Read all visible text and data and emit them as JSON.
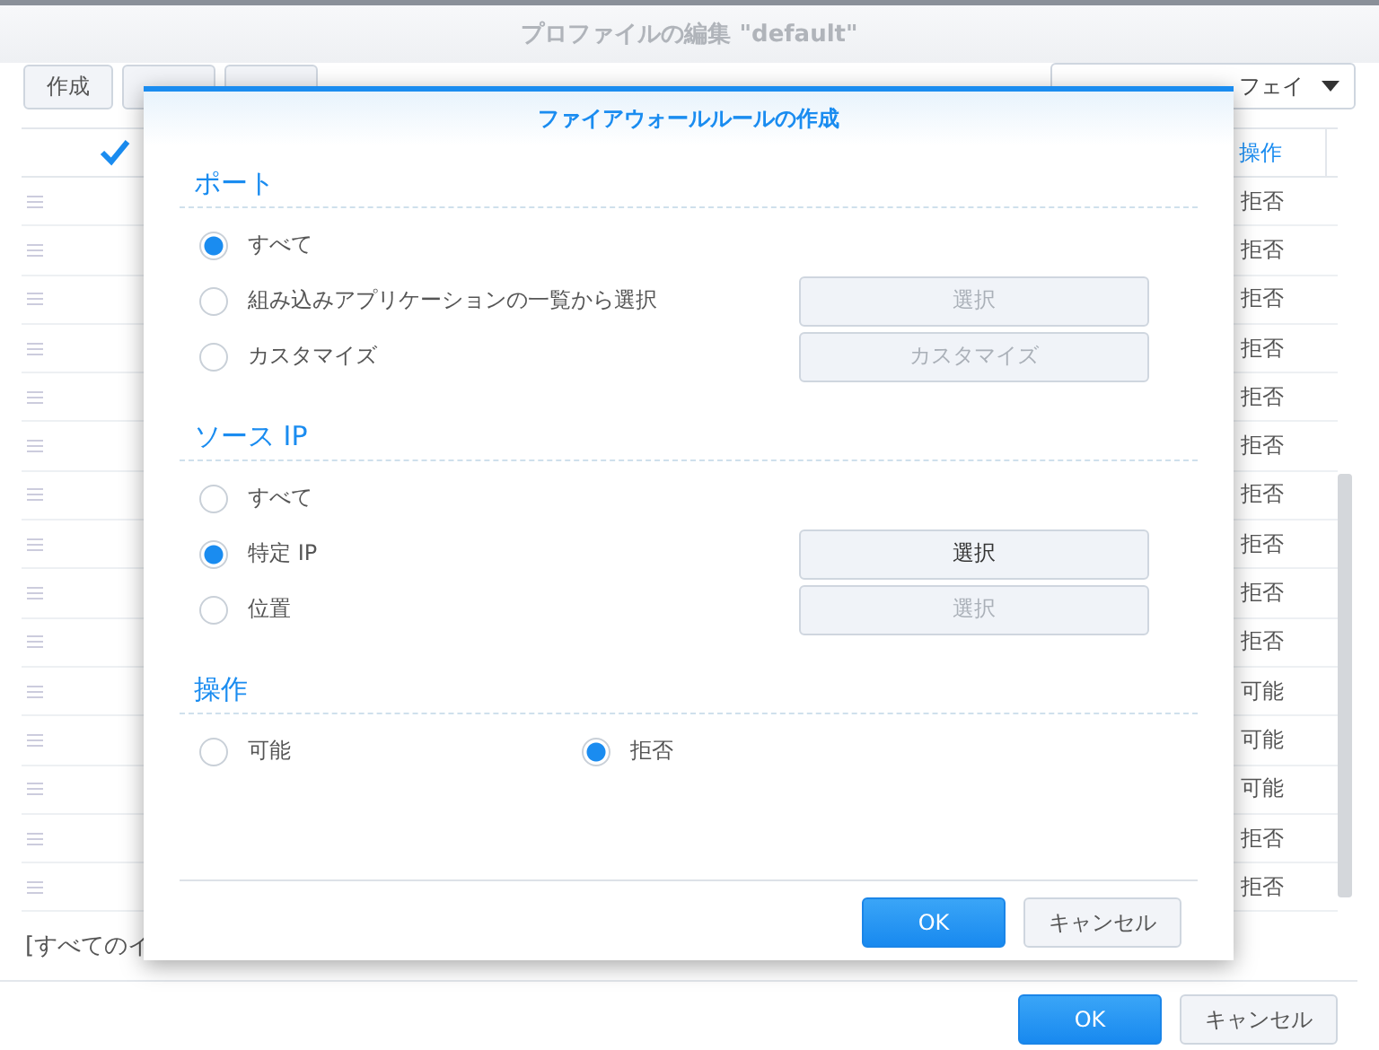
{
  "window": {
    "title": "プロファイルの編集 \"default\""
  },
  "toolbar": {
    "buttons": [
      {
        "label": "作成"
      }
    ],
    "filter": {
      "value": "フェイ"
    }
  },
  "table": {
    "header_checked": true,
    "columns": [
      {
        "label": "操作"
      }
    ],
    "rows": [
      {
        "action": "拒否"
      },
      {
        "action": "拒否"
      },
      {
        "action": "拒否"
      },
      {
        "action": "拒否"
      },
      {
        "action": "拒否"
      },
      {
        "action": "拒否"
      },
      {
        "action": "拒否"
      },
      {
        "action": "拒否"
      },
      {
        "action": "拒否"
      },
      {
        "action": "拒否"
      },
      {
        "action": "可能"
      },
      {
        "action": "可能"
      },
      {
        "action": "可能"
      },
      {
        "action": "拒否"
      },
      {
        "action": "拒否"
      }
    ]
  },
  "footer_text": "[すべてのイ",
  "buttons": [
    {
      "label": "OK",
      "kind": "primary"
    },
    {
      "label": "キャンセル",
      "kind": "secondary"
    }
  ],
  "dialog": {
    "title": "ファイアウォールルールの作成",
    "sections": [
      {
        "heading": "ポート",
        "kind": "stacked",
        "options": [
          {
            "label": "すべて",
            "selected": true
          },
          {
            "label": "組み込みアプリケーションの一覧から選択",
            "selected": false,
            "button": {
              "label": "選択",
              "disabled": true
            }
          },
          {
            "label": "カスタマイズ",
            "selected": false,
            "button": {
              "label": "カスタマイズ",
              "disabled": true
            }
          }
        ]
      },
      {
        "heading": "ソース IP",
        "kind": "stacked",
        "options": [
          {
            "label": "すべて",
            "selected": false
          },
          {
            "label": "特定 IP",
            "selected": true,
            "button": {
              "label": "選択",
              "disabled": false
            }
          },
          {
            "label": "位置",
            "selected": false,
            "button": {
              "label": "選択",
              "disabled": true
            }
          }
        ]
      },
      {
        "heading": "操作",
        "kind": "row",
        "options": [
          {
            "label": "可能",
            "selected": false
          },
          {
            "label": "拒否",
            "selected": true
          }
        ]
      }
    ],
    "buttons": [
      {
        "label": "OK",
        "kind": "primary"
      },
      {
        "label": "キャンセル",
        "kind": "secondary"
      }
    ]
  }
}
